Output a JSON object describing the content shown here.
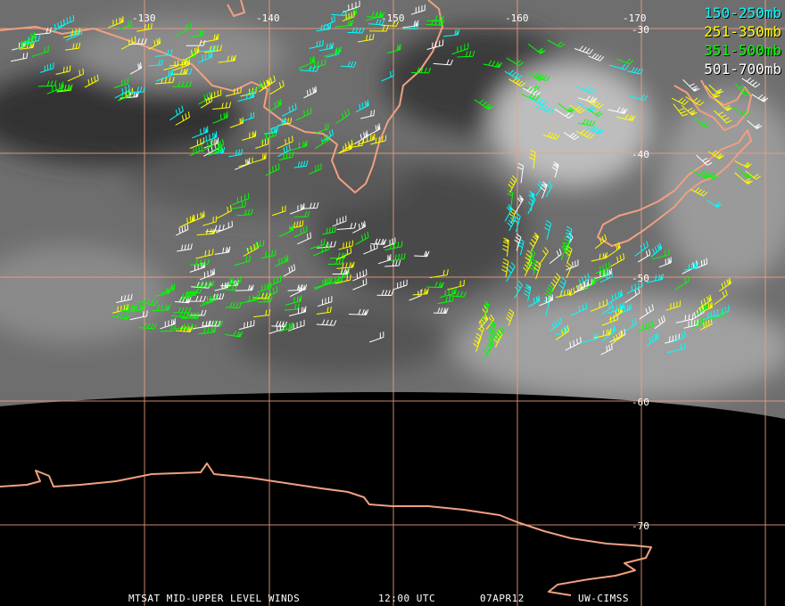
{
  "legend": [
    {
      "label": "150-250mb",
      "color": "#00ffff"
    },
    {
      "label": "251-350mb",
      "color": "#ffff00"
    },
    {
      "label": "351-500mb",
      "color": "#00ff00"
    },
    {
      "label": "501-700mb",
      "color": "#ffffff"
    }
  ],
  "grid": {
    "longitude_labels": [
      "-130",
      "-140",
      "-150",
      "-160",
      "-170"
    ],
    "latitude_labels": [
      "-30",
      "-40",
      "-50",
      "-60",
      "-70"
    ]
  },
  "footer": {
    "product": "MTSAT MID-UPPER LEVEL WINDS",
    "time": "12:00 UTC",
    "date": "07APR12",
    "source": "UW-CIMSS"
  },
  "colors": {
    "coastline": "#f0a080",
    "gridline": "#f0a080",
    "no_data": "#000000",
    "imagery_base": "#6e6e6e"
  }
}
